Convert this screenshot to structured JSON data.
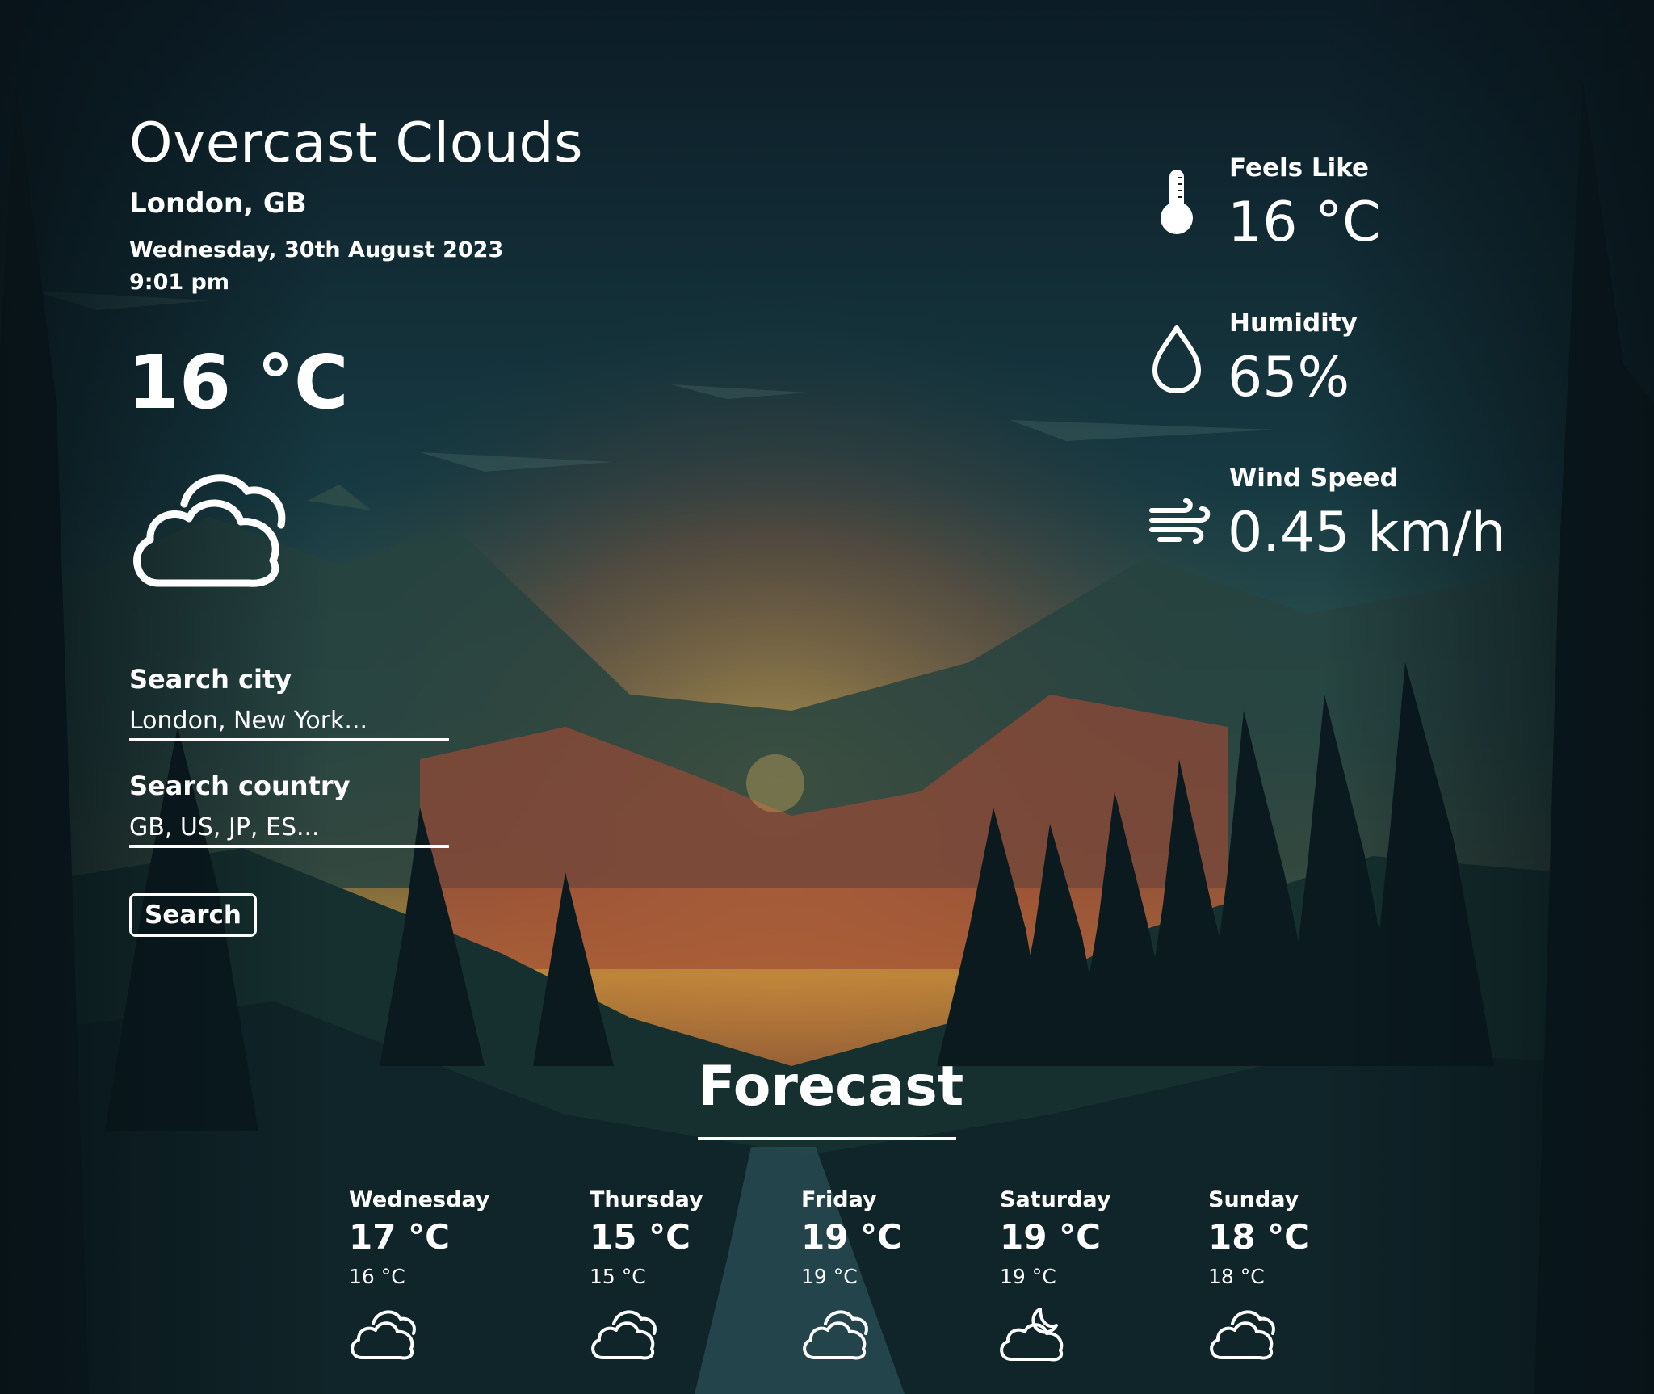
{
  "current": {
    "condition": "Overcast Clouds",
    "location": "London, GB",
    "date": "Wednesday, 30th August 2023",
    "time": "9:01 pm",
    "temperature": "16 °C",
    "icon": "cloudy-icon"
  },
  "search": {
    "city_label": "Search city",
    "city_placeholder": "London, New York...",
    "country_label": "Search country",
    "country_placeholder": "GB, US, JP, ES...",
    "button_label": "Search"
  },
  "stats": {
    "feels_like": {
      "label": "Feels Like",
      "value": "16 °C",
      "icon": "thermometer-icon"
    },
    "humidity": {
      "label": "Humidity",
      "value": "65%",
      "icon": "water-drop-icon"
    },
    "wind": {
      "label": "Wind Speed",
      "value": "0.45 km/h",
      "icon": "wind-icon"
    }
  },
  "forecast": {
    "title": "Forecast",
    "days": [
      {
        "day": "Wednesday",
        "max": "17 °C",
        "min": "16 °C",
        "icon": "cloudy-icon"
      },
      {
        "day": "Thursday",
        "max": "15 °C",
        "min": "15 °C",
        "icon": "cloudy-icon"
      },
      {
        "day": "Friday",
        "max": "19 °C",
        "min": "19 °C",
        "icon": "cloudy-icon"
      },
      {
        "day": "Saturday",
        "max": "19 °C",
        "min": "19 °C",
        "icon": "cloudy-moon-icon"
      },
      {
        "day": "Sunday",
        "max": "18 °C",
        "min": "18 °C",
        "icon": "cloudy-icon"
      }
    ]
  },
  "colors": {
    "text": "#ffffff",
    "sky_top": "#0d1f29",
    "sky_mid": "#1f4a50",
    "horizon": "#c89a3a",
    "sunset_red": "#a8452f",
    "forest_dark": "#0e2126"
  }
}
